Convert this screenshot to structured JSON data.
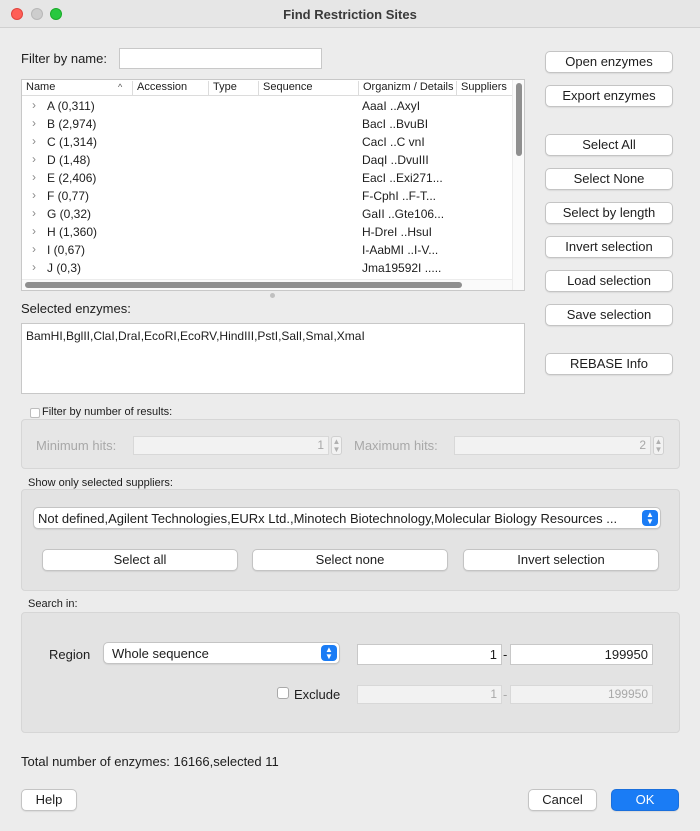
{
  "window": {
    "title": "Find Restriction Sites"
  },
  "filter": {
    "label": "Filter by name:",
    "value": ""
  },
  "table": {
    "columns": [
      "Name",
      "Accession",
      "Type",
      "Sequence",
      "Organizm / Details",
      "Suppliers"
    ],
    "sort_indicator": "^",
    "rows": [
      {
        "name": "A (0,311)",
        "organism": "AaaI ..AxyI"
      },
      {
        "name": "B (2,974)",
        "organism": "BacI ..BvuBI"
      },
      {
        "name": "C (1,314)",
        "organism": "CacI ..C vnI"
      },
      {
        "name": "D (1,48)",
        "organism": "DaqI ..DvuIII"
      },
      {
        "name": "E (2,406)",
        "organism": "EacI ..Exi271..."
      },
      {
        "name": "F (0,77)",
        "organism": "F-CphI ..F-T..."
      },
      {
        "name": "G (0,32)",
        "organism": "GaII ..Gte106..."
      },
      {
        "name": "H (1,360)",
        "organism": "H-DreI ..HsuI"
      },
      {
        "name": "I (0,67)",
        "organism": "I-AabMI ..I-V..."
      },
      {
        "name": "J (0,3)",
        "organism": "Jma19592I ....."
      }
    ]
  },
  "right_buttons": {
    "open": "Open enzymes",
    "export": "Export enzymes",
    "select_all": "Select All",
    "select_none": "Select None",
    "select_by_length": "Select by length",
    "invert": "Invert selection",
    "load": "Load selection",
    "save": "Save selection",
    "rebase": "REBASE Info"
  },
  "selected": {
    "label": "Selected enzymes:",
    "value": "BamHI,BglII,ClaI,DraI,EcoRI,EcoRV,HindIII,PstI,SalI,SmaI,XmaI"
  },
  "results_filter": {
    "label": "Filter by number of results:",
    "min_label": "Minimum hits:",
    "min_value": "1",
    "max_label": "Maximum hits:",
    "max_value": "2",
    "enabled": false
  },
  "suppliers": {
    "label": "Show only selected suppliers:",
    "value": "Not defined,Agilent Technologies,EURx Ltd.,Minotech Biotechnology,Molecular Biology Resources ...",
    "select_all": "Select all",
    "select_none": "Select none",
    "invert": "Invert selection"
  },
  "search_in": {
    "label": "Search  in:",
    "region_label": "Region",
    "region_value": "Whole sequence",
    "from": "1",
    "to": "199950",
    "dash": "-",
    "exclude_label": "Exclude",
    "exclude_from": "1",
    "exclude_to": "199950",
    "exclude_checked": false
  },
  "status": {
    "total": "Total number of enzymes: 16166,selected 11"
  },
  "footer": {
    "help": "Help",
    "cancel": "Cancel",
    "ok": "OK"
  },
  "colors": {
    "accent": "#1a7cf5",
    "window_bg": "#ececec",
    "close": "#ff5f57",
    "maximize": "#28c840"
  },
  "icons": [
    "close-icon",
    "minimize-icon",
    "maximize-icon",
    "chevron-right-icon",
    "sort-up-icon",
    "stepper-icon",
    "popup-arrows-icon"
  ]
}
